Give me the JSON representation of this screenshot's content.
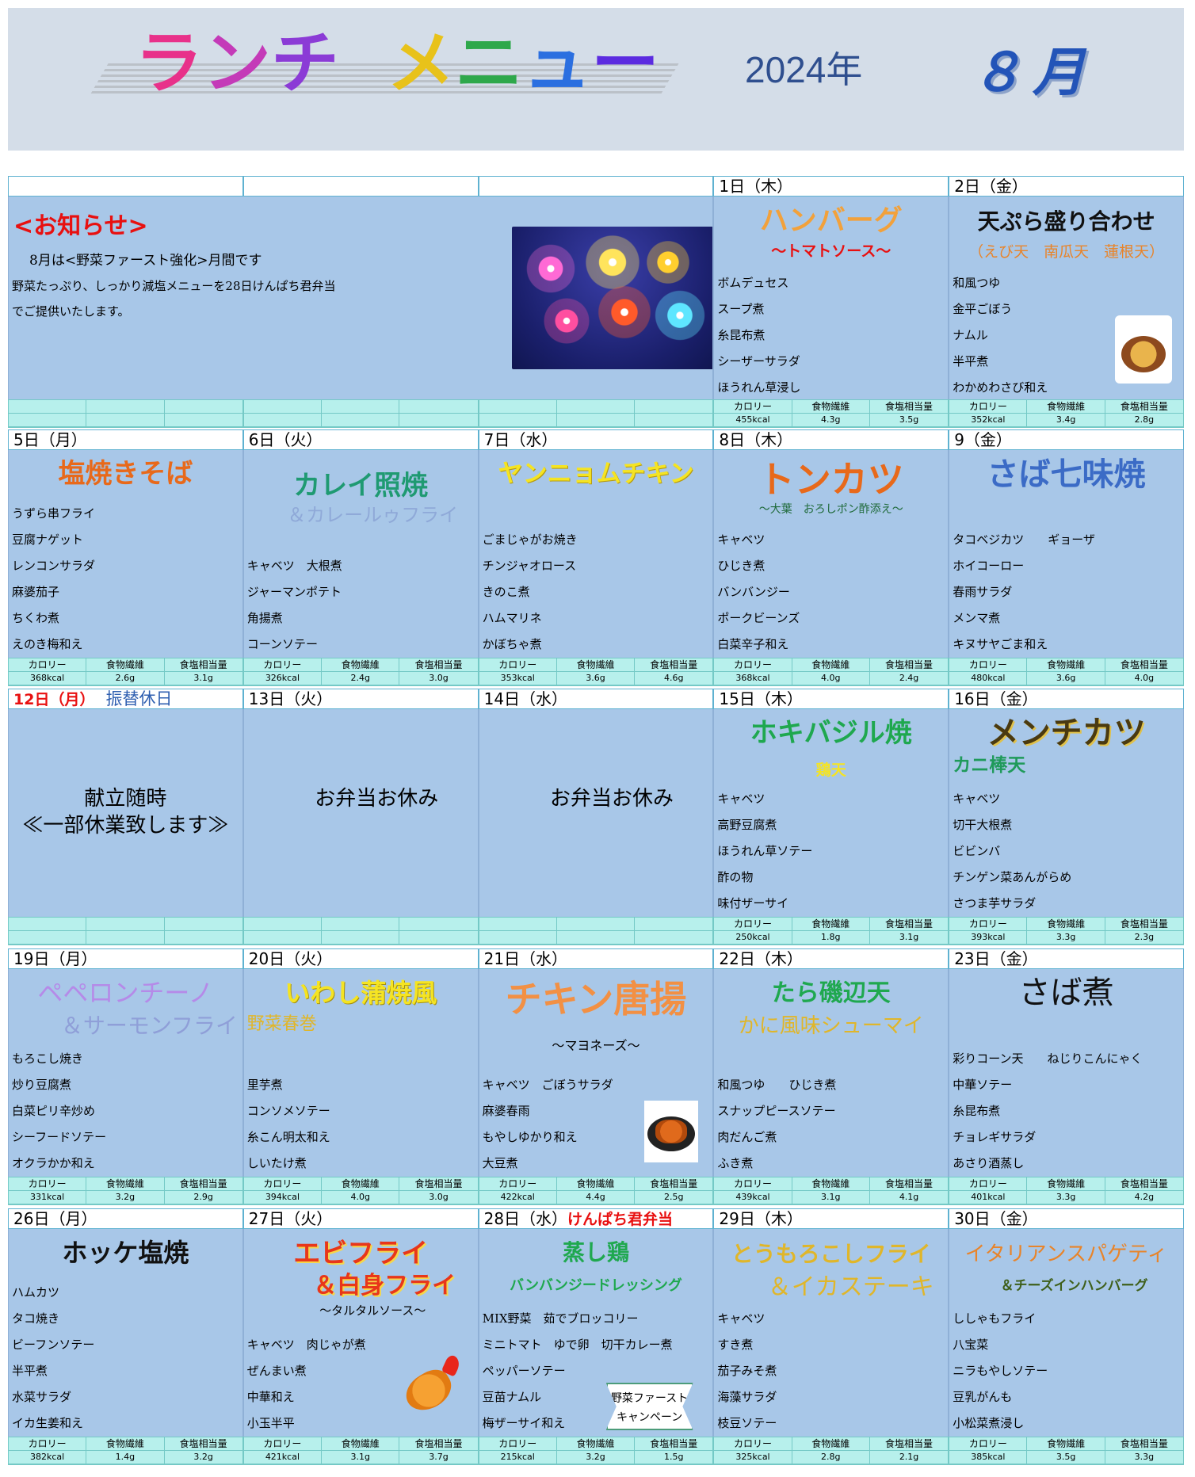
{
  "header": {
    "title_chars": [
      {
        "t": "ラ",
        "c": "#e8318a"
      },
      {
        "t": "ン",
        "c": "#c43ab8"
      },
      {
        "t": "チ",
        "c": "#8b3bd6"
      },
      {
        "t": "メ",
        "c": "#e8c21a"
      },
      {
        "t": "ニ",
        "c": "#2ea84b"
      },
      {
        "t": "ュ",
        "c": "#2b6fe0"
      },
      {
        "t": "ー",
        "c": "#5b2be0"
      }
    ],
    "year": "2024年",
    "month": "８月"
  },
  "nutrition_labels": {
    "cal": "カロリー",
    "fiber": "食物繊維",
    "salt": "食塩相当量"
  },
  "weeks": [
    {
      "dates": [
        "",
        "",
        "",
        "1日（木）",
        "2日（金）"
      ],
      "notice": {
        "title": "<お知らせ>",
        "line1": "8月は<野菜ファースト強化>月間です",
        "line2": "野菜たっぷり、しっかり減塩メニューを28日けんぱち君弁当",
        "line3": "でご提供いたします。"
      },
      "days": [
        {
          "dish": "ハンバーグ",
          "sub": "～トマトソース～",
          "sides": [
            "ボムデュセス",
            "スープ煮",
            "糸昆布煮",
            "シーザーサラダ",
            "ほうれん草浸し"
          ],
          "cal": "455kcal",
          "fiber": "4.3g",
          "salt": "3.5g"
        },
        {
          "dish": "天ぷら盛り合わせ",
          "sub": "（えび天　南瓜天　蓮根天）",
          "sides": [
            "和風つゆ",
            "金平ごぼう",
            "ナムル",
            "半平煮",
            "わかめわさび和え"
          ],
          "cal": "352kcal",
          "fiber": "3.4g",
          "salt": "2.8g"
        }
      ]
    },
    {
      "dates": [
        "5日（月）",
        "6日（火）",
        "7日（水）",
        "8日（木）",
        "9（金）"
      ],
      "days": [
        {
          "dish": "塩焼きそば",
          "sub": "",
          "sides": [
            "うずら串フライ",
            "豆腐ナゲット",
            "レンコンサラダ",
            "麻婆茄子",
            "ちくわ煮",
            "えのき梅和え"
          ],
          "cal": "368kcal",
          "fiber": "2.6g",
          "salt": "3.1g"
        },
        {
          "dish": "カレイ照焼",
          "sub": "＆カレールゥフライ",
          "sides": [
            "キャベツ　大根煮",
            "ジャーマンポテト",
            "角揚煮",
            "コーンソテー"
          ],
          "cal": "326kcal",
          "fiber": "2.4g",
          "salt": "3.0g"
        },
        {
          "dish": "ヤンニョムチキン",
          "sub": "",
          "sides": [
            "ごまじゃがお焼き",
            "チンジャオロース",
            "きのこ煮",
            "ハムマリネ",
            "かぼちゃ煮"
          ],
          "cal": "353kcal",
          "fiber": "3.6g",
          "salt": "4.6g"
        },
        {
          "dish": "トンカツ",
          "sub": "～大葉　おろしポン酢添え～",
          "sides": [
            "キャベツ",
            "ひじき煮",
            "バンバンジー",
            "ポークビーンズ",
            "白菜辛子和え"
          ],
          "cal": "368kcal",
          "fiber": "4.0g",
          "salt": "2.4g"
        },
        {
          "dish": "さば七味焼",
          "sub": "",
          "sides": [
            "タコベジカツ　　ギョーザ",
            "",
            "ホイコーロー",
            "春雨サラダ",
            "メンマ煮",
            "キヌサヤごま和え"
          ],
          "cal": "480kcal",
          "fiber": "3.6g",
          "salt": "4.0g"
        }
      ]
    },
    {
      "dates": [
        "12日（月）",
        "13日（火）",
        "14日（水）",
        "15日（木）",
        "16日（金）"
      ],
      "note12": "振替休日",
      "closed": {
        "mon_line1": "献立随時",
        "mon_line2": "≪一部休業致します≫",
        "tue": "お弁当お休み",
        "wed": "お弁当お休み"
      },
      "days": [
        {
          "dish": "ホキバジル焼",
          "sub": "鶏天",
          "sides": [
            "キャベツ",
            "高野豆腐煮",
            "ほうれん草ソテー",
            "酢の物",
            "味付ザーサイ"
          ],
          "cal": "250kcal",
          "fiber": "1.8g",
          "salt": "3.1g"
        },
        {
          "dish": "メンチカツ",
          "sub": "カニ棒天",
          "sides": [
            "キャベツ",
            "切干大根煮",
            "ビビンバ",
            "チンゲン菜あんがらめ",
            "さつま芋サラダ"
          ],
          "cal": "393kcal",
          "fiber": "3.3g",
          "salt": "2.3g"
        }
      ]
    },
    {
      "dates": [
        "19日（月）",
        "20日（火）",
        "21日（水）",
        "22日（木）",
        "23日（金）"
      ],
      "days": [
        {
          "dish": "ペペロンチーノ",
          "sub": "＆サーモンフライ",
          "sides": [
            "もろこし焼き",
            "炒り豆腐煮",
            "白菜ピリ辛炒め",
            "シーフードソテー",
            "オクラかか和え"
          ],
          "cal": "331kcal",
          "fiber": "3.2g",
          "salt": "2.9g"
        },
        {
          "dish": "いわし蒲焼風",
          "sub": "野菜春巻",
          "sides": [
            "里芋煮",
            "コンソメソテー",
            "糸こん明太和え",
            "しいたけ煮"
          ],
          "cal": "394kcal",
          "fiber": "4.0g",
          "salt": "3.0g"
        },
        {
          "dish": "チキン唐揚",
          "sub": "～マヨネーズ～",
          "sides": [
            "キャベツ　ごぼうサラダ",
            "麻婆春雨",
            "もやしゆかり和え",
            "大豆煮"
          ],
          "cal": "422kcal",
          "fiber": "4.4g",
          "salt": "2.5g"
        },
        {
          "dish": "たら磯辺天",
          "sub": "かに風味シューマイ",
          "sides": [
            "和風つゆ　　ひじき煮",
            "スナップピースソテー",
            "肉だんご煮",
            "ふき煮"
          ],
          "cal": "439kcal",
          "fiber": "3.1g",
          "salt": "4.1g"
        },
        {
          "dish": "さば煮",
          "sub": "",
          "sides": [
            "彩りコーン天　　ねじりこんにゃく",
            "",
            "中華ソテー",
            "糸昆布煮",
            "チョレギサラダ",
            "あさり酒蒸し"
          ],
          "cal": "401kcal",
          "fiber": "3.3g",
          "salt": "4.2g"
        }
      ]
    },
    {
      "dates": [
        "26日（月）",
        "27日（火）",
        "28日（水）",
        "29日（木）",
        "30日（金）"
      ],
      "bento28": "けんぱち君弁当",
      "campaign": {
        "line1": "野菜ファースト",
        "line2": "キャンペーン"
      },
      "days": [
        {
          "dish": "ホッケ塩焼",
          "sub": "",
          "sides": [
            "ハムカツ",
            "タコ焼き",
            "ビーフンソテー",
            "半平煮",
            "水菜サラダ",
            "イカ生姜和え"
          ],
          "cal": "382kcal",
          "fiber": "1.4g",
          "salt": "3.2g"
        },
        {
          "dish": "エビフライ",
          "sub": "＆白身フライ",
          "sub2": "～タルタルソース～",
          "sides": [
            "キャベツ　肉じゃが煮",
            "ぜんまい煮",
            "中華和え",
            "小玉半平"
          ],
          "cal": "421kcal",
          "fiber": "3.1g",
          "salt": "3.7g"
        },
        {
          "dish": "蒸し鶏",
          "sub": "バンバンジードレッシング",
          "sides": [
            "MIX野菜　茹でブロッコリー",
            "ミニトマト　ゆで卵　切干カレー煮",
            "ペッパーソテー",
            "豆苗ナムル",
            "梅ザーサイ和え"
          ],
          "cal": "215kcal",
          "fiber": "3.2g",
          "salt": "1.5g"
        },
        {
          "dish": "とうもろこしフライ",
          "sub": "＆イカステーキ",
          "sides": [
            "キャベツ",
            "すき煮",
            "茄子みそ煮",
            "海藻サラダ",
            "枝豆ソテー"
          ],
          "cal": "325kcal",
          "fiber": "2.8g",
          "salt": "2.1g"
        },
        {
          "dish": "イタリアンスパゲティ",
          "sub": "＆チーズインハンバーグ",
          "sides": [
            "ししゃもフライ",
            "八宝菜",
            "ニラもやしソテー",
            "豆乳がんも",
            "小松菜煮浸し"
          ],
          "cal": "385kcal",
          "fiber": "3.5g",
          "salt": "3.3g"
        }
      ]
    }
  ]
}
